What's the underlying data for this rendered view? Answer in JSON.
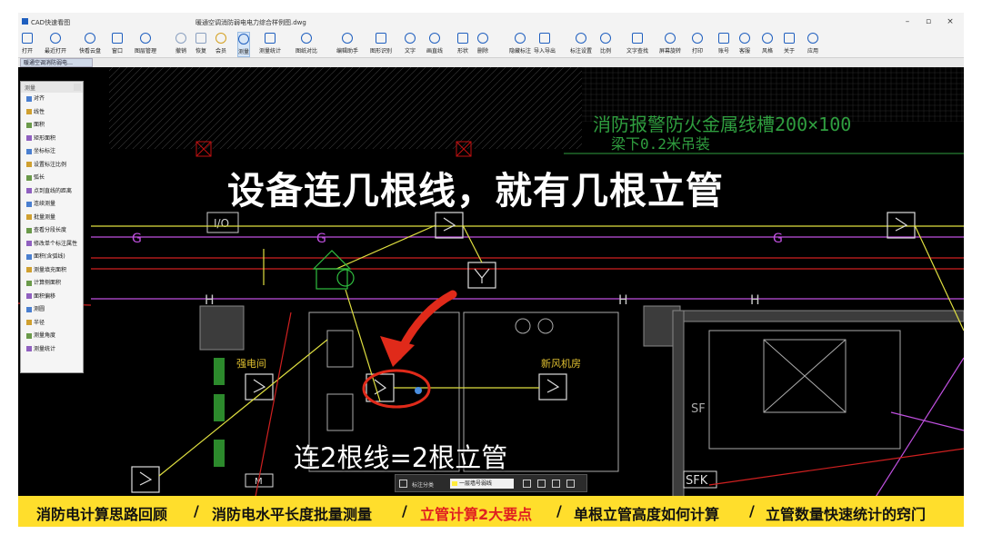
{
  "window": {
    "app_title": "CAD快速看图",
    "doc_title": "暖通空调消防弱电电力综合样例图.dwg",
    "min_label": "–",
    "max_label": "▫",
    "close_label": "×"
  },
  "toolbar": [
    {
      "label": "打开",
      "icon": "folder-icon"
    },
    {
      "label": "最近打开",
      "icon": "clock-icon"
    },
    {
      "label": "快看云盘",
      "icon": "cloud-icon"
    },
    {
      "label": "窗口",
      "icon": "window-icon"
    },
    {
      "label": "图层管理",
      "icon": "layers-icon"
    },
    {
      "label": "撤销",
      "icon": "undo-icon"
    },
    {
      "label": "恢复",
      "icon": "redo-icon"
    },
    {
      "label": "会员",
      "icon": "vip-icon"
    },
    {
      "label": "测量",
      "icon": "measure-icon"
    },
    {
      "label": "测量统计",
      "icon": "measure-stats-icon"
    },
    {
      "label": "图纸对比",
      "icon": "compare-icon"
    },
    {
      "label": "编辑助手",
      "icon": "edit-helper-icon"
    },
    {
      "label": "图形识别",
      "icon": "shape-recognize-icon"
    },
    {
      "label": "文字",
      "icon": "text-icon"
    },
    {
      "label": "画直线",
      "icon": "line-icon"
    },
    {
      "label": "形状",
      "icon": "shape-icon"
    },
    {
      "label": "删除",
      "icon": "eraser-icon"
    },
    {
      "label": "隐藏标注",
      "icon": "hide-icon"
    },
    {
      "label": "导入导出",
      "icon": "import-export-icon"
    },
    {
      "label": "标注设置",
      "icon": "annotation-settings-icon"
    },
    {
      "label": "比例",
      "icon": "scale-icon"
    },
    {
      "label": "文字查找",
      "icon": "text-search-icon"
    },
    {
      "label": "屏幕旋转",
      "icon": "rotate-icon"
    },
    {
      "label": "打印",
      "icon": "print-icon"
    },
    {
      "label": "账号",
      "icon": "user-icon"
    },
    {
      "label": "客服",
      "icon": "headset-icon"
    },
    {
      "label": "风格",
      "icon": "style-icon"
    },
    {
      "label": "关于",
      "icon": "info-icon"
    },
    {
      "label": "应用",
      "icon": "apps-icon"
    }
  ],
  "tab": {
    "label": "暖通空调消防弱电…"
  },
  "panel": {
    "title": "测量",
    "items": [
      "对齐",
      "线性",
      "面积",
      "矩形面积",
      "坐标标注",
      "设置标注比例",
      "弧长",
      "点到直线的距离",
      "连续测量",
      "批量测量",
      "查看分段长度",
      "修改单个标注属性",
      "面积(含弧线)",
      "测量填充面积",
      "计算侧面积",
      "面积偏移",
      "测圆",
      "半径",
      "测量角度",
      "测量统计"
    ]
  },
  "cad_text": {
    "fire_tray": "消防报警防火金属线槽200×100",
    "fire_tray2": "梁下0.2米吊装",
    "io_label": "I/O",
    "strong_room": "强电间",
    "room2": "新风机房",
    "sf": "SF",
    "sfk": "SFK",
    "m_label": "M",
    "g_label": "G",
    "h_label": "H"
  },
  "overlay": {
    "headline": "设备连几根线，就有几根立管",
    "subline": "连2根线=2根立管"
  },
  "snapbar": {
    "label": "标注分类",
    "selected": "一层墙号弱线"
  },
  "banner": {
    "items": [
      "消防电计算思路回顾",
      "消防电水平长度批量测量",
      "立管计算2大要点",
      "单根立管高度如何计算",
      "立管数量快速统计的窍门"
    ],
    "highlight_index": 2,
    "separator": "/"
  },
  "colors": {
    "accent": "#1f5fbf",
    "banner_bg": "#ffde2c",
    "highlight": "#e02020",
    "cad_bg": "#000000"
  }
}
